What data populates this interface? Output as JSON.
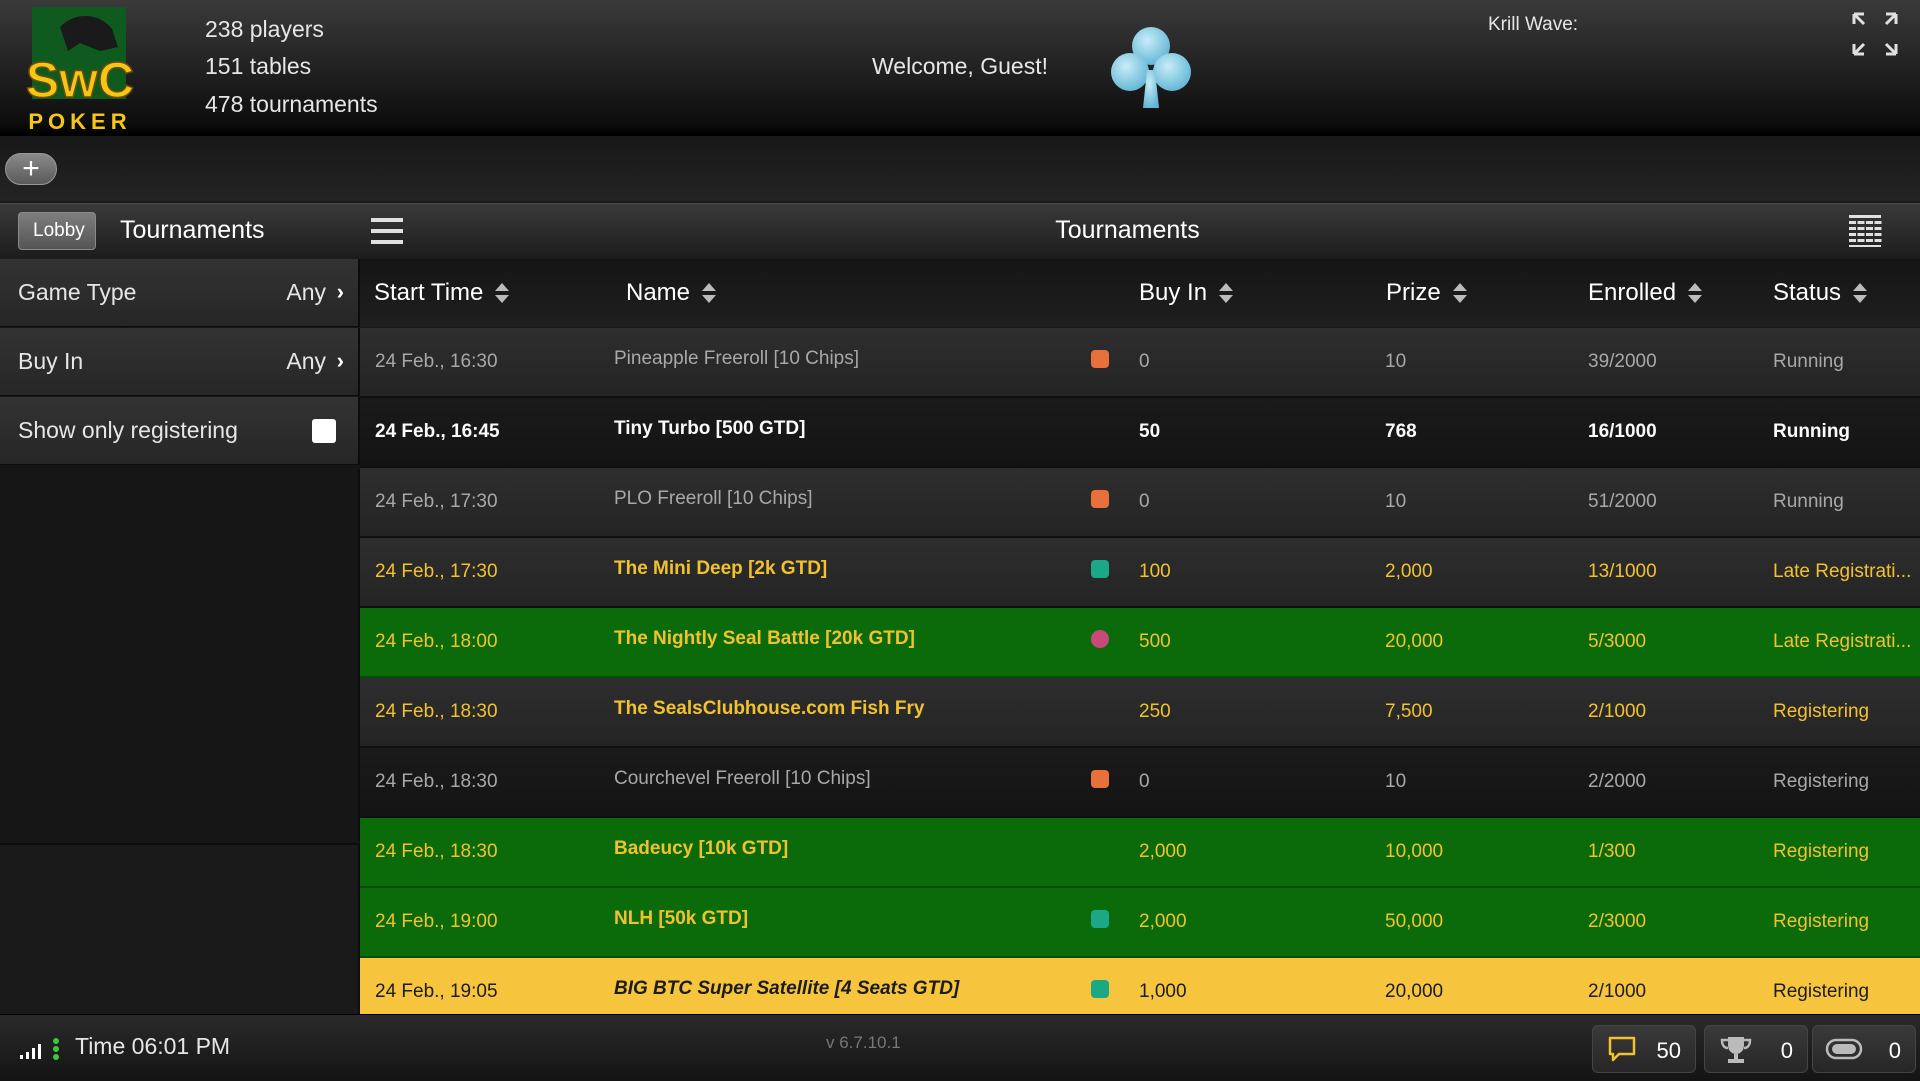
{
  "header": {
    "logo": {
      "brand": "SwC",
      "sub": "POKER"
    },
    "stats": {
      "players": "238 players",
      "tables": "151 tables",
      "tournaments": "478 tournaments"
    },
    "welcome": "Welcome, Guest!",
    "krill_wave": "Krill Wave:"
  },
  "toolbar": {
    "add_label": "+"
  },
  "titlebar": {
    "back_label": "Lobby",
    "left_title": "Tournaments",
    "center_title": "Tournaments"
  },
  "filters": {
    "game_type": {
      "label": "Game Type",
      "value": "Any",
      "arrow": "›"
    },
    "buy_in": {
      "label": "Buy In",
      "value": "Any",
      "arrow": "›"
    },
    "show_only": {
      "label": "Show only registering",
      "checked": false
    }
  },
  "table": {
    "headers": [
      "Start Time",
      "Name",
      "Buy In",
      "Prize",
      "Enrolled",
      "Status"
    ],
    "rows": [
      {
        "time": "24 Feb., 16:30",
        "name": "Pineapple Freeroll [10 Chips]",
        "icon": "turbo-icon",
        "buyin": "0",
        "prize": "10",
        "enrolled": "39/2000",
        "status": "Running"
      },
      {
        "time": "24 Feb., 16:45",
        "name": "Tiny Turbo [500 GTD]",
        "icon": "",
        "buyin": "50",
        "prize": "768",
        "enrolled": "16/1000",
        "status": "Running"
      },
      {
        "time": "24 Feb., 17:30",
        "name": "PLO Freeroll [10 Chips]",
        "icon": "turbo-icon",
        "buyin": "0",
        "prize": "10",
        "enrolled": "51/2000",
        "status": "Running"
      },
      {
        "time": "24 Feb., 17:30",
        "name": "The Mini Deep [2k GTD]",
        "icon": "rebuy-icon",
        "buyin": "100",
        "prize": "2,000",
        "enrolled": "13/1000",
        "status": "Late Registrati..."
      },
      {
        "time": "24 Feb., 18:00",
        "name": "The Nightly Seal Battle [20k GTD]",
        "icon": "bounty-icon",
        "buyin": "500",
        "prize": "20,000",
        "enrolled": "5/3000",
        "status": "Late Registrati..."
      },
      {
        "time": "24 Feb., 18:30",
        "name": "The SealsClubhouse.com Fish Fry",
        "icon": "",
        "buyin": "250",
        "prize": "7,500",
        "enrolled": "2/1000",
        "status": "Registering"
      },
      {
        "time": "24 Feb., 18:30",
        "name": "Courchevel Freeroll [10 Chips]",
        "icon": "turbo-icon",
        "buyin": "0",
        "prize": "10",
        "enrolled": "2/2000",
        "status": "Registering"
      },
      {
        "time": "24 Feb., 18:30",
        "name": "Badeucy [10k GTD]",
        "icon": "",
        "buyin": "2,000",
        "prize": "10,000",
        "enrolled": "1/300",
        "status": "Registering"
      },
      {
        "time": "24 Feb., 19:00",
        "name": "NLH [50k GTD]",
        "icon": "rebuy-icon",
        "buyin": "2,000",
        "prize": "50,000",
        "enrolled": "2/3000",
        "status": "Registering"
      },
      {
        "time": "24 Feb., 19:05",
        "name": "BIG BTC Super Satellite [4 Seats GTD]",
        "icon": "rebuy-icon",
        "buyin": "1,000",
        "prize": "20,000",
        "enrolled": "2/1000",
        "status": "Registering"
      }
    ]
  },
  "statusbar": {
    "time": "Time 06:01 PM",
    "version": "v 6.7.10.1",
    "chat_count": "50",
    "trophy_count": "0",
    "chip_count": "0"
  },
  "colors": {
    "row_green": "#0b6b0b",
    "row_gold": "#f6c53d",
    "text_yellow": "#f2c12e",
    "club_blue": "#7ec8e3",
    "logo_green": "#0f5a1e",
    "logo_yellow": "#f5c518"
  }
}
